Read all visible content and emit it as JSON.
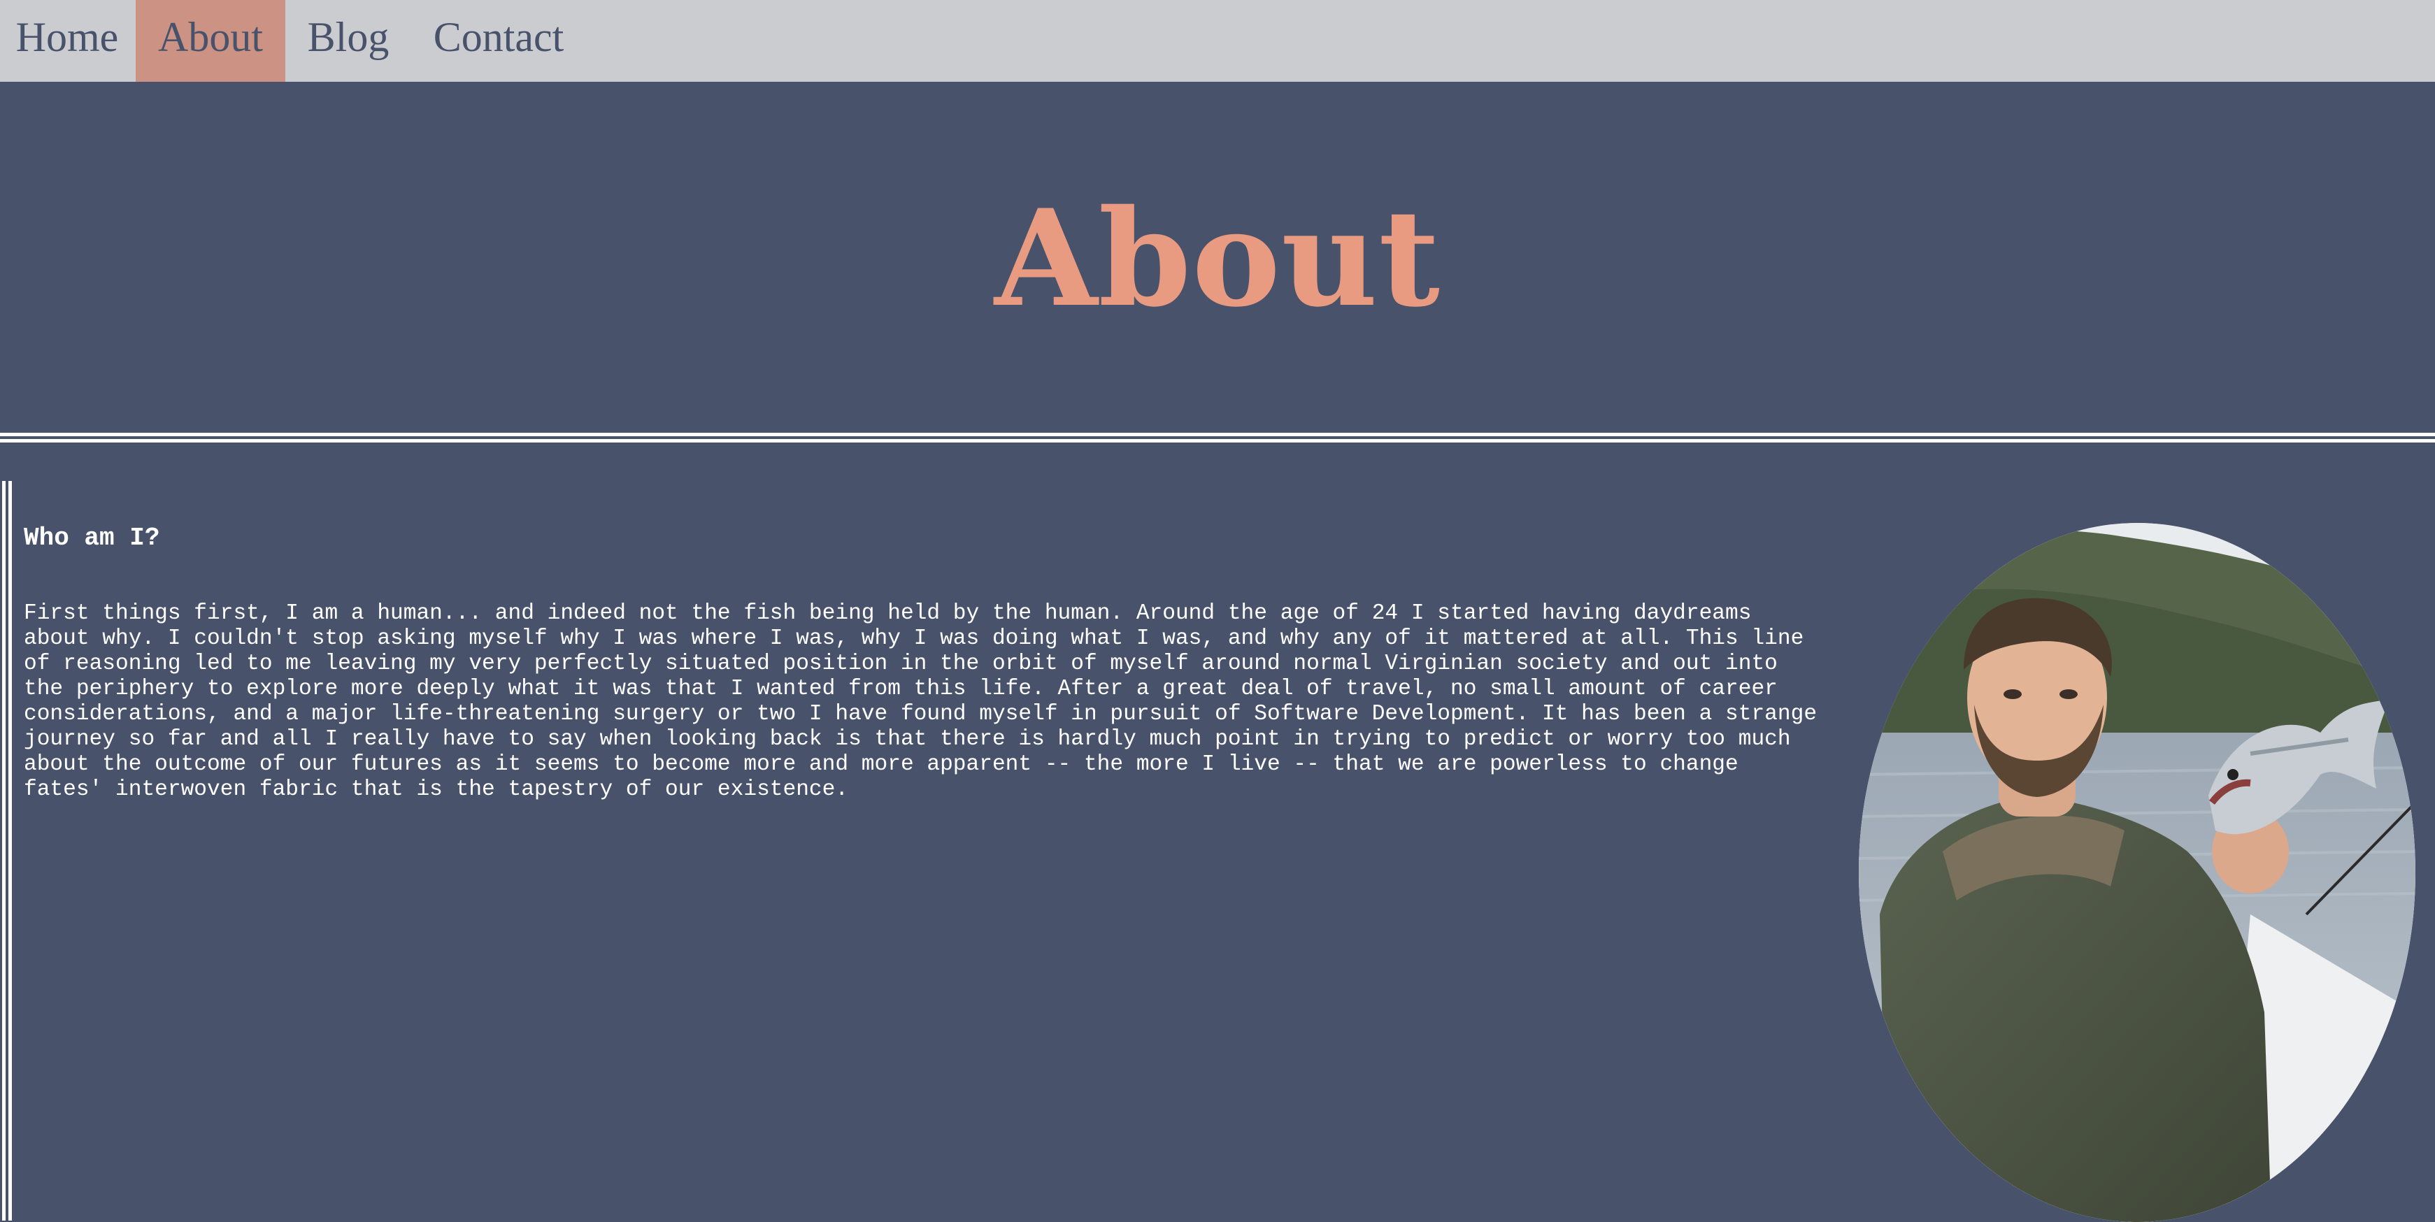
{
  "nav": {
    "items": [
      {
        "label": "Home",
        "active": false
      },
      {
        "label": "About",
        "active": true
      },
      {
        "label": "Blog",
        "active": false
      },
      {
        "label": "Contact",
        "active": false
      }
    ]
  },
  "header": {
    "title": "About"
  },
  "main": {
    "heading": "Who am I?",
    "bio": "First things first, I am a human... and indeed not the fish being held by the human. Around the age of 24 I started having daydreams about why. I couldn't stop asking myself why I was where I was, why I was doing what I was, and why any of it mattered at all. This line of reasoning led to me leaving my very perfectly situated position in the orbit of myself around normal Virginian society and out into the periphery to explore more deeply what it was that I wanted from this life. After a great deal of travel, no small amount of career considerations, and a major life-threatening surgery or two I have found myself in pursuit of Software Development. It has been a strange journey so far and all I really have to say when looking back is that there is hardly much point in trying to predict or worry too much about the outcome of our futures as it seems to become more and more apparent -- the more I live -- that we are powerless to change fates' interwoven fabric that is the tapestry of our existence."
  },
  "colors": {
    "background": "#48526b",
    "nav_background": "#cbccd0",
    "nav_active": "#cc9384",
    "accent": "#e99b82",
    "text": "#ffffff"
  },
  "photo": {
    "icon": "profile-photo"
  }
}
